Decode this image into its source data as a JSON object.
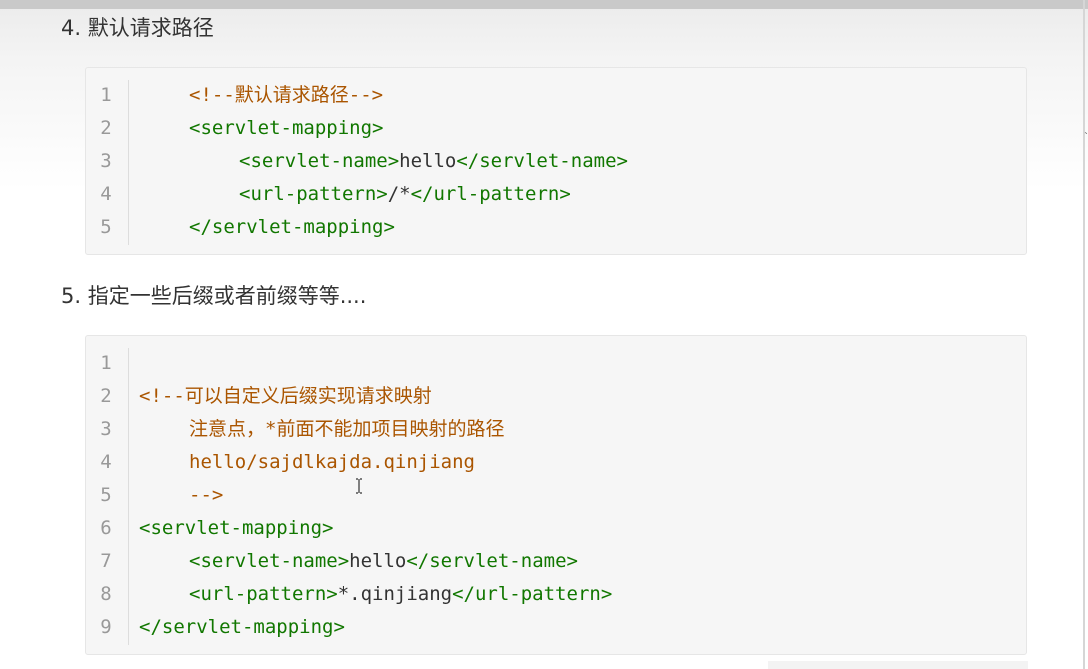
{
  "headings": {
    "h4": "4. 默认请求路径",
    "h5": "5. 指定一些后缀或者前缀等等...."
  },
  "code1": {
    "line_numbers": [
      "1",
      "2",
      "3",
      "4",
      "5"
    ],
    "lines": {
      "l1": {
        "comment": "<!--默认请求路径-->"
      },
      "l2": {
        "tag": "<servlet-mapping>"
      },
      "l3": {
        "open": "<servlet-name>",
        "text": "hello",
        "close": "</servlet-name>"
      },
      "l4": {
        "open": "<url-pattern>",
        "text": "/*",
        "close": "</url-pattern>"
      },
      "l5": {
        "tag": "</servlet-mapping>"
      }
    }
  },
  "code2": {
    "line_numbers": [
      "1",
      "2",
      "3",
      "4",
      "5",
      "6",
      "7",
      "8",
      "9"
    ],
    "lines": {
      "l2": {
        "comment": "<!--可以自定义后缀实现请求映射"
      },
      "l3": {
        "comment": "注意点，*前面不能加项目映射的路径"
      },
      "l4": {
        "comment": "hello/sajdlkajda.qinjiang"
      },
      "l5": {
        "comment": "-->"
      },
      "l6": {
        "tag": "<servlet-mapping>"
      },
      "l7": {
        "open": "<servlet-name>",
        "text": "hello",
        "close": "</servlet-name>"
      },
      "l8": {
        "open": "<url-pattern>",
        "text": "*.qinjiang",
        "close": "</url-pattern>"
      },
      "l9": {
        "tag": "</servlet-mapping>"
      }
    }
  },
  "colors": {
    "tag": "#117700",
    "comment": "#aa5500",
    "text": "#333333",
    "line_number": "#999999",
    "code_background": "#f6f6f6"
  },
  "icons": {
    "cursor": "text-cursor-icon"
  }
}
